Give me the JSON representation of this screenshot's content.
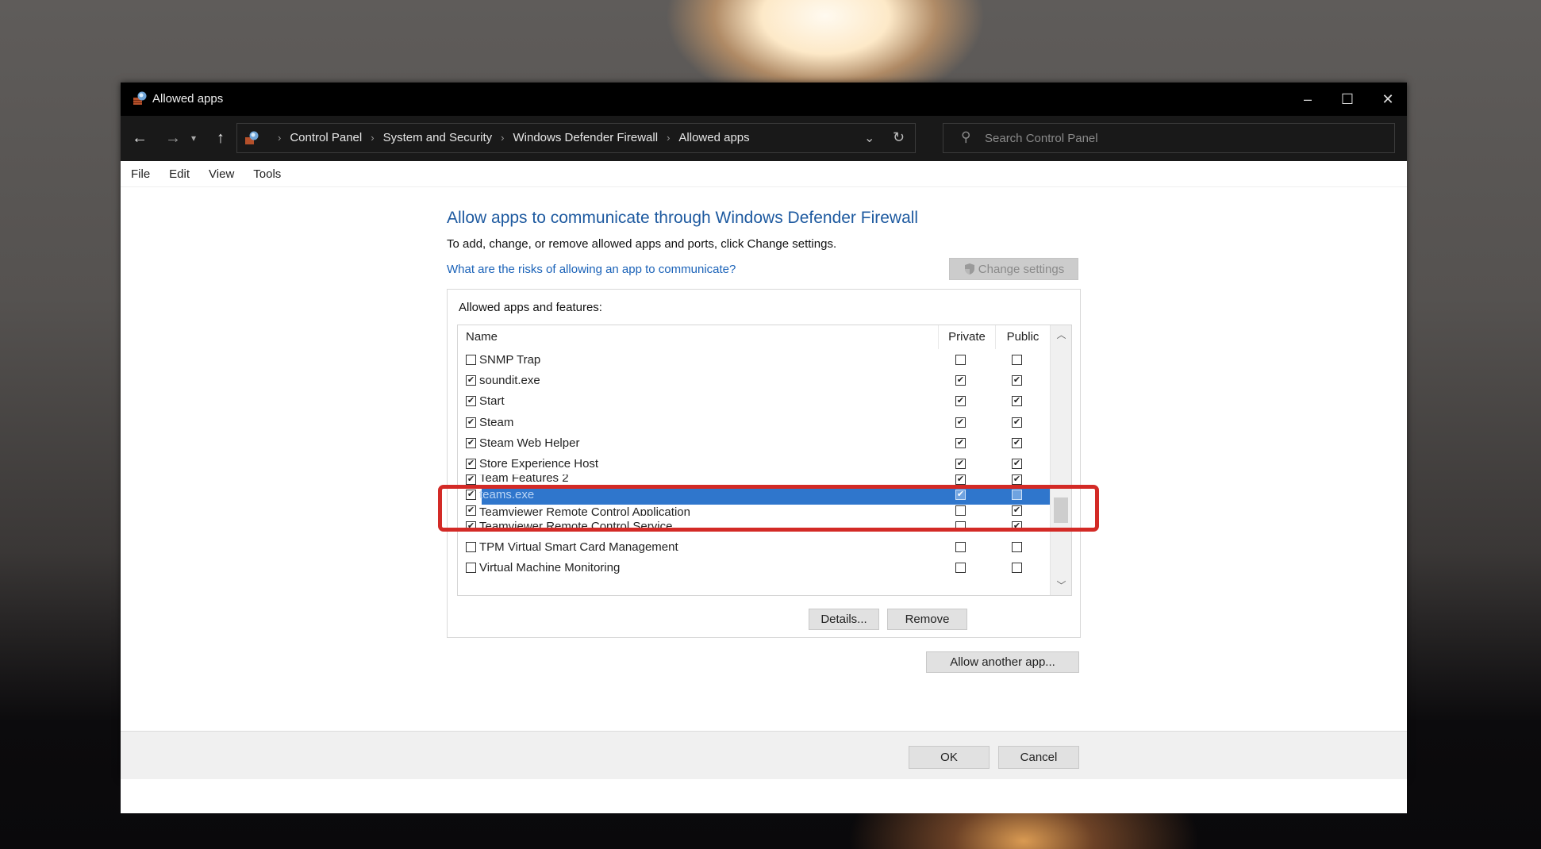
{
  "window": {
    "title": "Allowed apps",
    "controls": {
      "minimize": "–",
      "maximize": "☐",
      "close": "✕"
    }
  },
  "navigation": {
    "back_icon": "←",
    "forward_icon": "→",
    "recent_icon": "▾",
    "up_icon": "↑",
    "breadcrumbs": [
      "Control Panel",
      "System and Security",
      "Windows Defender Firewall",
      "Allowed apps"
    ],
    "separator": "›",
    "dropdown_icon": "⌄",
    "refresh_icon": "↻",
    "search": {
      "placeholder": "Search Control Panel",
      "value": "",
      "icon": "⚲"
    }
  },
  "menu": [
    "File",
    "Edit",
    "View",
    "Tools"
  ],
  "main": {
    "heading": "Allow apps to communicate through Windows Defender Firewall",
    "description": "To add, change, or remove allowed apps and ports, click Change settings.",
    "risk_link": "What are the risks of allowing an app to communicate?",
    "change_settings_button": "Change settings",
    "group_label": "Allowed apps and features:",
    "columns": {
      "name": "Name",
      "private": "Private",
      "public": "Public"
    },
    "rows": [
      {
        "name": "SNMP Trap",
        "enabled": false,
        "private": false,
        "public": false
      },
      {
        "name": "soundit.exe",
        "enabled": true,
        "private": true,
        "public": true
      },
      {
        "name": "Start",
        "enabled": true,
        "private": true,
        "public": true
      },
      {
        "name": "Steam",
        "enabled": true,
        "private": true,
        "public": true
      },
      {
        "name": "Steam Web Helper",
        "enabled": true,
        "private": true,
        "public": true
      },
      {
        "name": "Store Experience Host",
        "enabled": true,
        "private": true,
        "public": true
      },
      {
        "name": "Team Features 2",
        "enabled": true,
        "private": true,
        "public": true,
        "partially_hidden": true
      },
      {
        "name": "teams.exe",
        "enabled": true,
        "private": true,
        "public": false,
        "selected": true
      },
      {
        "name": "Teamviewer Remote Control Application",
        "enabled": true,
        "private": false,
        "public": true,
        "partially_hidden": true
      },
      {
        "name": "Teamviewer Remote Control Service",
        "enabled": true,
        "private": false,
        "public": true
      },
      {
        "name": "TPM Virtual Smart Card Management",
        "enabled": false,
        "private": false,
        "public": false
      },
      {
        "name": "Virtual Machine Monitoring",
        "enabled": false,
        "private": false,
        "public": false
      }
    ],
    "details_button": "Details...",
    "remove_button": "Remove",
    "allow_another_button": "Allow another app..."
  },
  "footer": {
    "ok_button": "OK",
    "cancel_button": "Cancel"
  },
  "annotation": {
    "highlight_color": "#d32a26",
    "highlighted_row": "teams.exe"
  },
  "colors": {
    "selection": "#2f76cc",
    "heading": "#1e5aa0",
    "link": "#1a62b8"
  }
}
